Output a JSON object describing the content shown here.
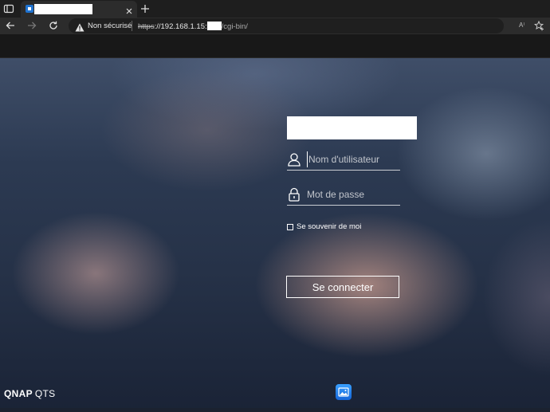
{
  "browser": {
    "tab": {
      "title": ""
    },
    "address_bar": {
      "security_label": "Non sécurisé",
      "url_scheme": "https",
      "url_host": "://192.168.1.15:",
      "url_path": "/cgi-bin/",
      "read_aloud_label": "A⁾"
    }
  },
  "login": {
    "username_placeholder": "Nom d'utilisateur",
    "password_placeholder": "Mot de passe",
    "remember_label": "Se souvenir de moi",
    "remember_checked": false,
    "submit_label": "Se connecter"
  },
  "footer": {
    "brand_primary": "QNAP",
    "brand_secondary": "QTS"
  },
  "icons": {
    "tab_actions": "tab-actions-icon",
    "close_tab": "close-icon",
    "new_tab": "plus-icon",
    "back": "back-arrow-icon",
    "forward": "forward-arrow-icon",
    "refresh": "refresh-icon",
    "warning": "warning-icon",
    "favorites": "star-plus-icon",
    "user": "user-icon",
    "lock": "lock-icon",
    "wallpaper": "image-icon"
  },
  "colors": {
    "accent": "#1f73d1"
  }
}
